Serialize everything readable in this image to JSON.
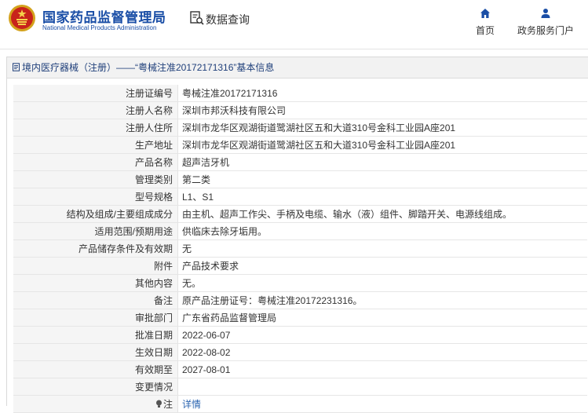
{
  "header": {
    "org_name_cn": "国家药品监督管理局",
    "org_name_en": "National Medical Products Administration",
    "query_label": "数据查询",
    "nav": [
      {
        "label": "首页",
        "icon": "home-icon"
      },
      {
        "label": "政务服务门户",
        "icon": "user-icon"
      }
    ]
  },
  "panel": {
    "title": "境内医疗器械（注册）——“粤械注准20172171316”基本信息",
    "title_icon": "document-icon"
  },
  "fields": [
    {
      "label": "注册证编号",
      "value": "粤械注准20172171316"
    },
    {
      "label": "注册人名称",
      "value": "深圳市邦沃科技有限公司"
    },
    {
      "label": "注册人住所",
      "value": "深圳市龙华区观湖街道鹭湖社区五和大道310号金科工业园A座201"
    },
    {
      "label": "生产地址",
      "value": "深圳市龙华区观湖街道鹭湖社区五和大道310号金科工业园A座201"
    },
    {
      "label": "产品名称",
      "value": "超声洁牙机"
    },
    {
      "label": "管理类别",
      "value": "第二类"
    },
    {
      "label": "型号规格",
      "value": "L1、S1"
    },
    {
      "label": "结构及组成/主要组成成分",
      "value": "由主机、超声工作尖、手柄及电缆、输水（液）组件、脚踏开关、电源线组成。"
    },
    {
      "label": "适用范围/预期用途",
      "value": "供临床去除牙垢用。"
    },
    {
      "label": "产品储存条件及有效期",
      "value": "无"
    },
    {
      "label": "附件",
      "value": "产品技术要求"
    },
    {
      "label": "其他内容",
      "value": "无。"
    },
    {
      "label": "备注",
      "value": "原产品注册证号：粤械注准20172231316。"
    },
    {
      "label": "审批部门",
      "value": "广东省药品监督管理局"
    },
    {
      "label": "批准日期",
      "value": "2022-06-07"
    },
    {
      "label": "生效日期",
      "value": "2022-08-02"
    },
    {
      "label": "有效期至",
      "value": "2027-08-01"
    },
    {
      "label": "变更情况",
      "value": ""
    }
  ],
  "note_row": {
    "label": "注",
    "icon": "lightbulb-icon",
    "link_text": "详情"
  },
  "colors": {
    "brand_blue": "#1a4ea6",
    "link_blue": "#2a64b0",
    "label_bg": "#f5f5f5"
  }
}
